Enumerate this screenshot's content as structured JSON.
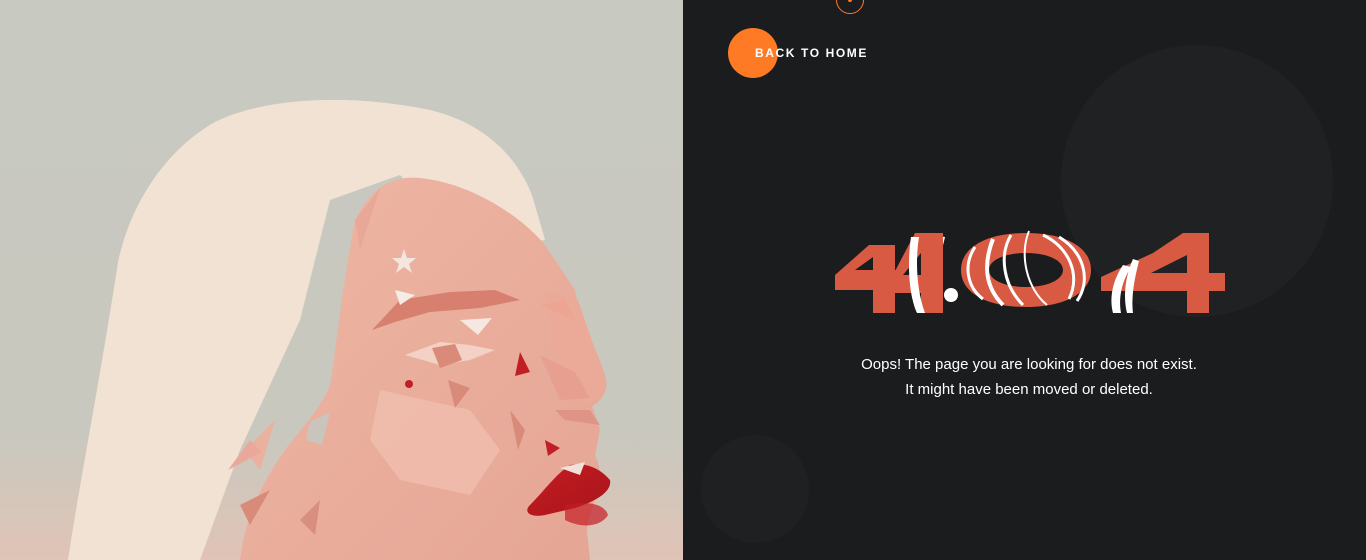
{
  "nav": {
    "back_home_label": "BACK TO HOME"
  },
  "error": {
    "code": "404",
    "message_line_1": "Oops! The page you are looking for does not exist.",
    "message_line_2": "It might have been moved or deleted."
  },
  "colors": {
    "accent": "#ff7a25",
    "code_red": "#d85a43",
    "background_dark": "#1b1c1e",
    "illustration_bg": "#c8c9c0"
  },
  "icons": {
    "top_ornament": "ring-dot-icon",
    "back_home": "orange-circle-icon"
  }
}
